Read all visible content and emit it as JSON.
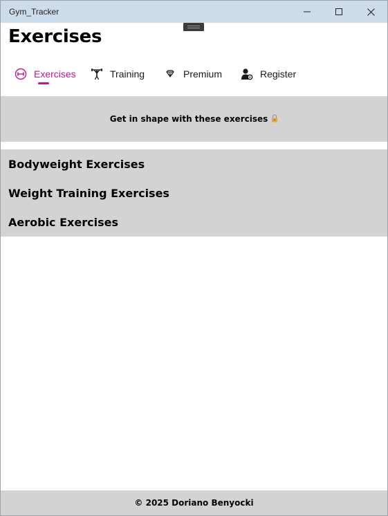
{
  "window": {
    "title": "Gym_Tracker",
    "controls": {
      "minimize_icon": "minimize-icon",
      "maximize_icon": "maximize-icon",
      "close_icon": "close-icon"
    }
  },
  "page": {
    "title": "Exercises"
  },
  "nav": {
    "accent_color": "#c0168f",
    "items": [
      {
        "label": "Exercises",
        "icon": "dumbbell-icon",
        "active": true
      },
      {
        "label": "Training",
        "icon": "weightlifter-icon",
        "active": false
      },
      {
        "label": "Premium",
        "icon": "diamond-icon",
        "active": false
      },
      {
        "label": "Register",
        "icon": "user-settings-icon",
        "active": false
      }
    ]
  },
  "banner": {
    "text": "Get in shape with these exercises",
    "icon": "lock-icon",
    "background": "#d3d3d3"
  },
  "categories": [
    {
      "label": "Bodyweight Exercises"
    },
    {
      "label": "Weight Training Exercises"
    },
    {
      "label": "Aerobic Exercises"
    }
  ],
  "footer": {
    "text": "© 2025 Doriano Benyocki"
  }
}
